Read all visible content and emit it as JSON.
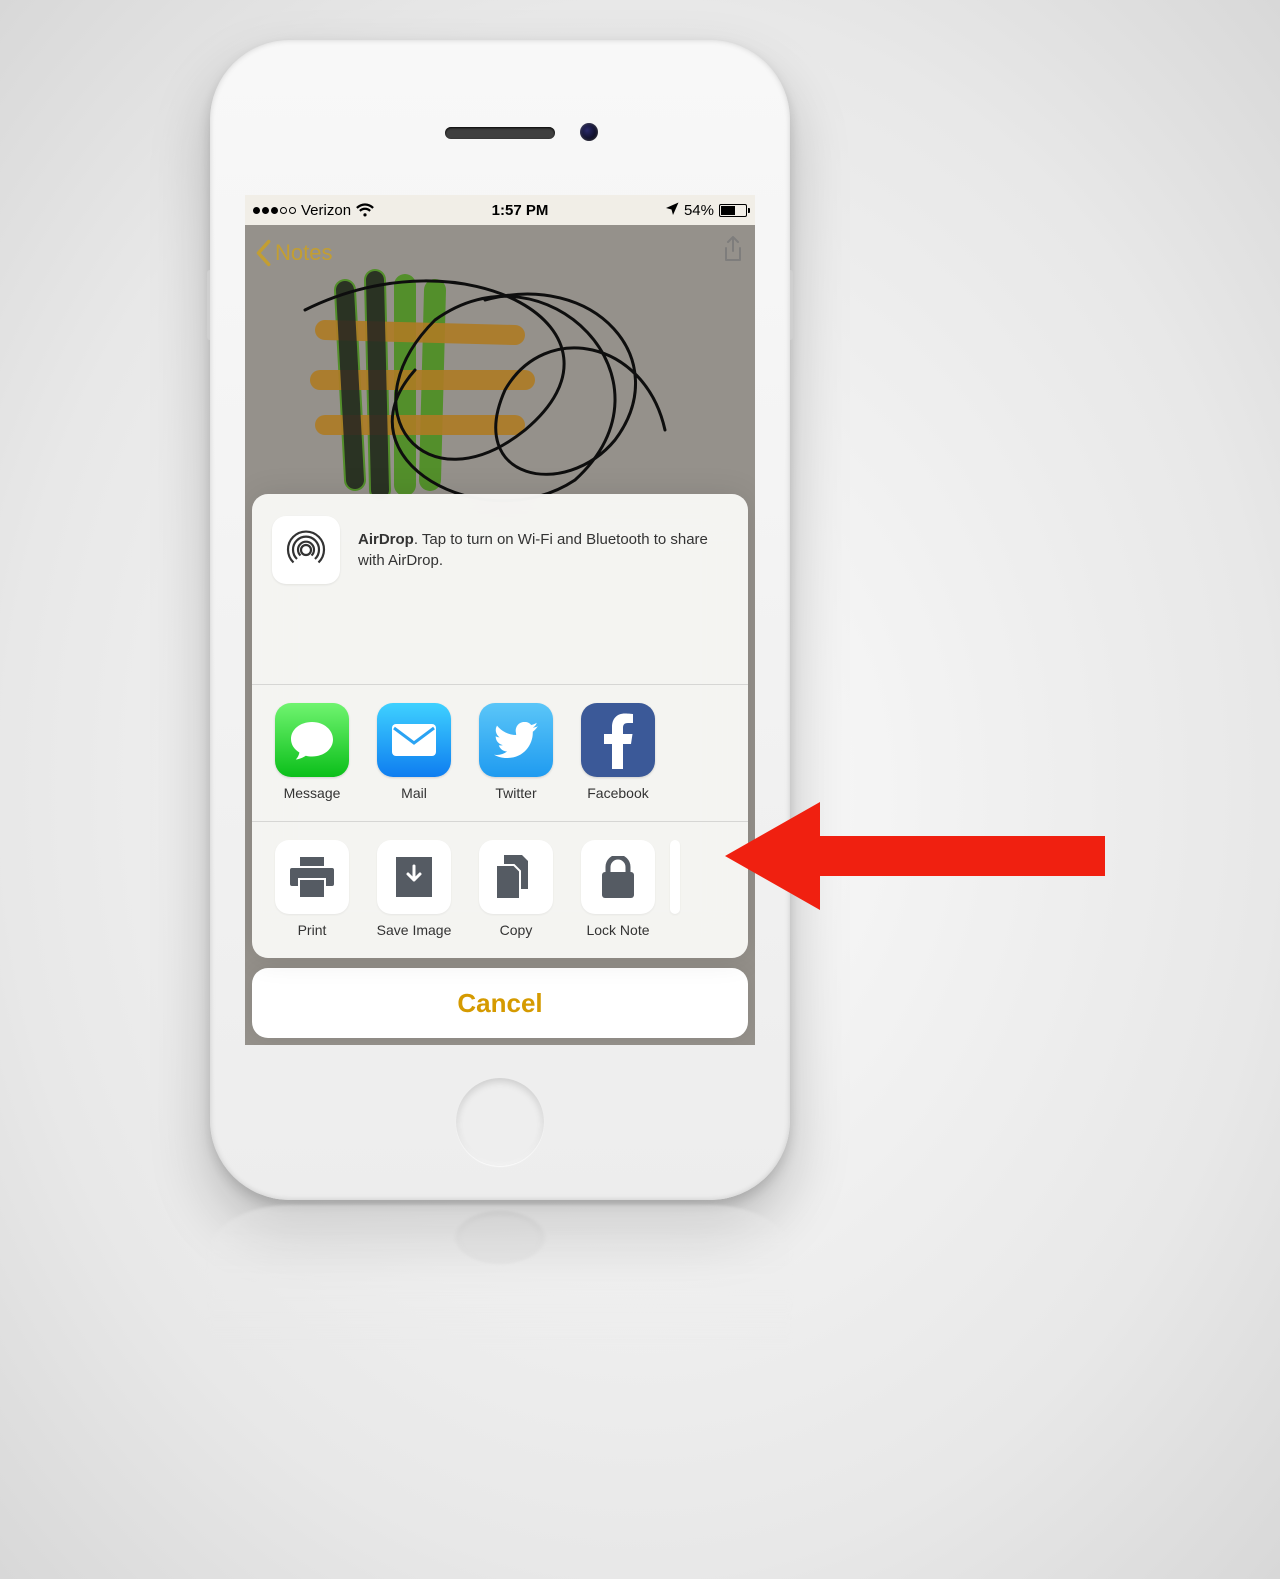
{
  "status": {
    "carrier": "Verizon",
    "time": "1:57 PM",
    "battery_pct": "54%"
  },
  "nav": {
    "back_label": "Notes"
  },
  "airdrop": {
    "title": "AirDrop",
    "description": ". Tap to turn on Wi-Fi and Bluetooth to share with AirDrop."
  },
  "apps": {
    "message": "Message",
    "mail": "Mail",
    "twitter": "Twitter",
    "facebook": "Facebook"
  },
  "actions": {
    "print": "Print",
    "save_image": "Save Image",
    "copy": "Copy",
    "lock_note": "Lock Note"
  },
  "cancel_label": "Cancel"
}
